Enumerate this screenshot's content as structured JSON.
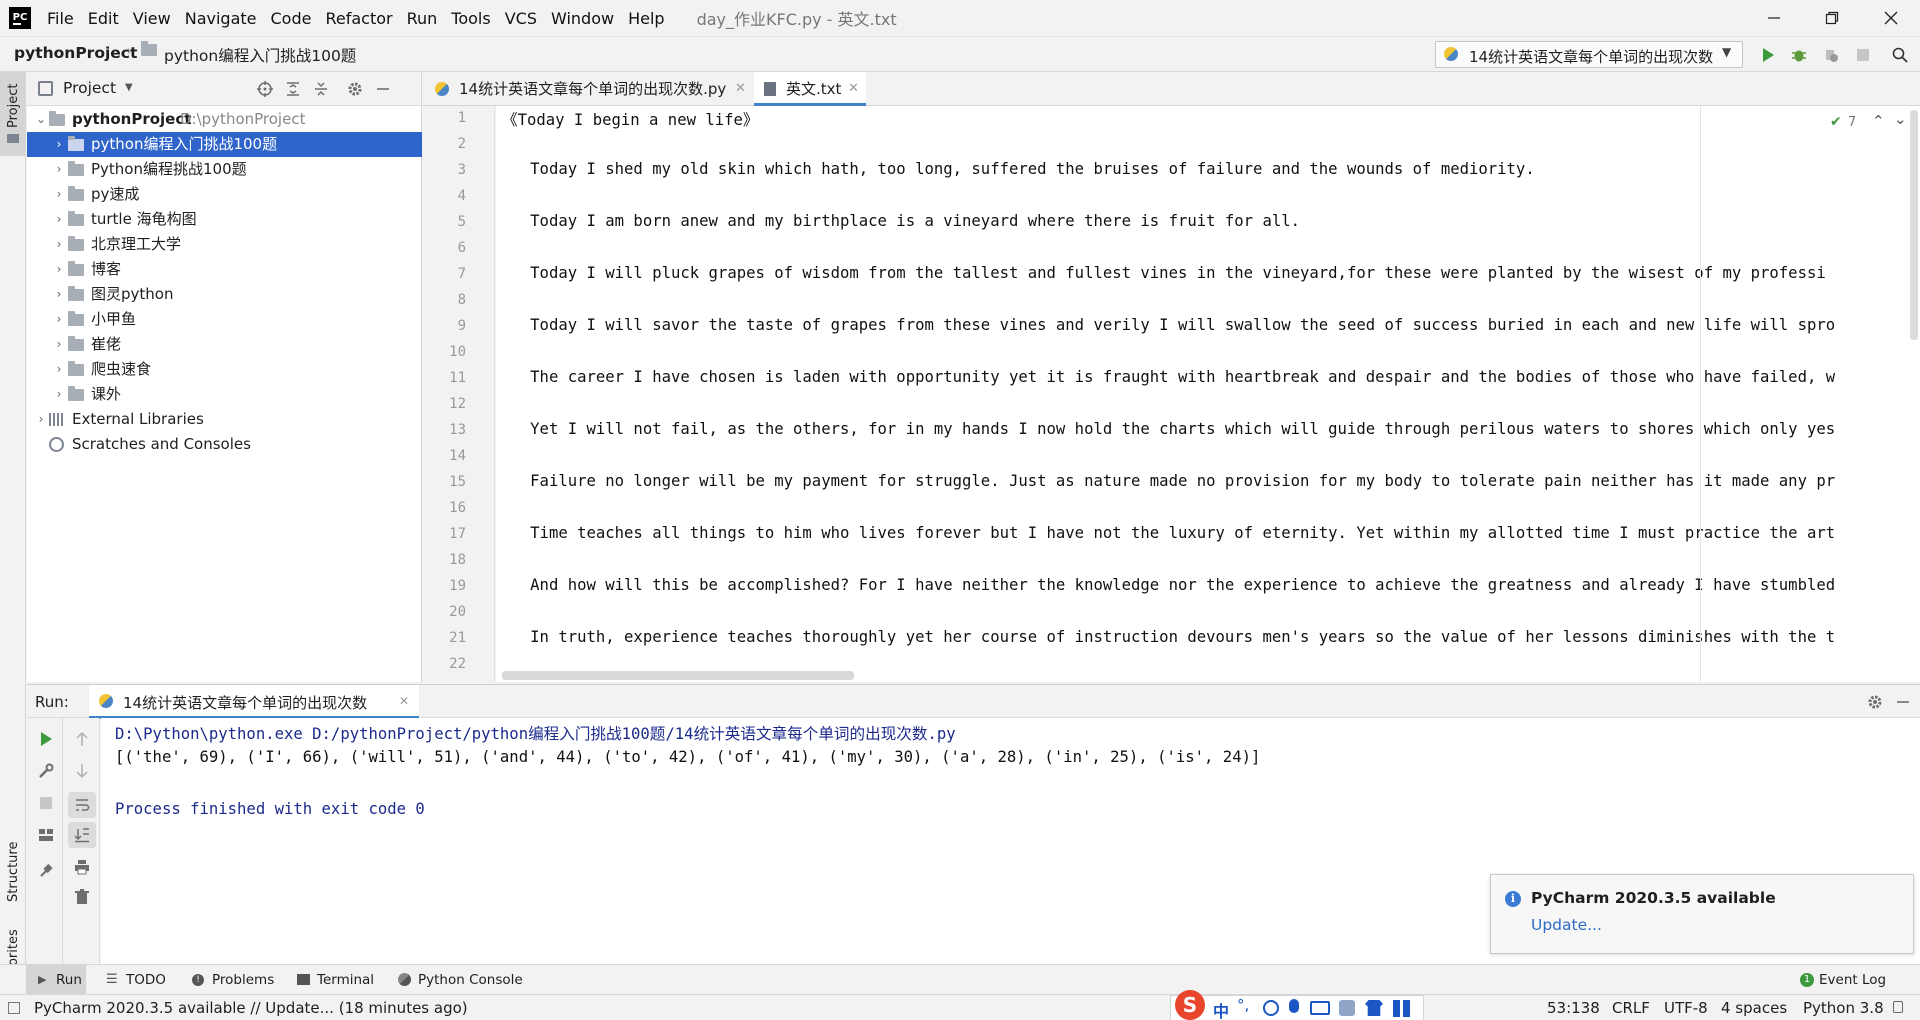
{
  "menubar": {
    "logo": "PC",
    "items": [
      "File",
      "Edit",
      "View",
      "Navigate",
      "Code",
      "Refactor",
      "Run",
      "Tools",
      "VCS",
      "Window",
      "Help"
    ],
    "window_title": "day_作业KFC.py - 英文.txt"
  },
  "navbar": {
    "project": "pythonProject",
    "folder": "python编程入门挑战100题",
    "run_config": "14统计英语文章每个单词的出现次数"
  },
  "left_strip": {
    "project_label": "Project",
    "structure_label": "Structure",
    "favorites_label": "Favorites"
  },
  "project_panel": {
    "title": "Project",
    "root": {
      "name": "pythonProject",
      "path": "D:\\pythonProject"
    },
    "folders": [
      "python编程入门挑战100题",
      "Python编程挑战100题",
      "py速成",
      "turtle 海龟构图",
      "北京理工大学",
      "博客",
      "图灵python",
      "小甲鱼",
      "崔佬",
      "爬虫速食",
      "课外"
    ],
    "external": "External Libraries",
    "scratches": "Scratches and Consoles"
  },
  "editor": {
    "tabs": [
      {
        "label": "14统计英语文章每个单词的出现次数.py"
      },
      {
        "label": "英文.txt"
      }
    ],
    "inspection_count": "7",
    "line_numbers": [
      "1",
      "2",
      "3",
      "4",
      "5",
      "6",
      "7",
      "8",
      "9",
      "10",
      "11",
      "12",
      "13",
      "14",
      "15",
      "16",
      "17",
      "18",
      "19",
      "20",
      "21",
      "22"
    ],
    "lines": [
      "《Today I begin a new life》",
      "",
      "   Today I shed my old skin which hath, too long, suffered the bruises of failure and the wounds of mediority.",
      "",
      "   Today I am born anew and my birthplace is a vineyard where there is fruit for all.",
      "",
      "   Today I will pluck grapes of wisdom from the tallest and fullest vines in the vineyard,for these were planted by the wisest of my professi",
      "",
      "   Today I will savor the taste of grapes from these vines and verily I will swallow the seed of success buried in each and new life will spro",
      "",
      "   The career I have chosen is laden with opportunity yet it is fraught with heartbreak and despair and the bodies of those who have failed, w",
      "",
      "   Yet I will not fail, as the others, for in my hands I now hold the charts which will guide through perilous waters to shores which only yes",
      "",
      "   Failure no longer will be my payment for struggle. Just as nature made no provision for my body to tolerate pain neither has it made any pr",
      "",
      "   Time teaches all things to him who lives forever but I have not the luxury of eternity. Yet within my allotted time I must practice the art",
      "",
      "   And how will this be accomplished? For I have neither the knowledge nor the experience to achieve the greatness and already I have stumbled",
      "",
      "   In truth, experience teaches thoroughly yet her course of instruction devours men's years so the value of her lessons diminishes with the t",
      ""
    ]
  },
  "run": {
    "label": "Run:",
    "tab": "14统计英语文章每个单词的出现次数",
    "console": [
      "D:\\Python\\python.exe D:/pythonProject/python编程入门挑战100题/14统计英语文章每个单词的出现次数.py",
      "[('the', 69), ('I', 66), ('will', 51), ('and', 44), ('to', 42), ('of', 41), ('my', 30), ('a', 28), ('in', 25), ('is', 24)]",
      "",
      "Process finished with exit code 0"
    ]
  },
  "notification": {
    "title": "PyCharm 2020.3.5 available",
    "link": "Update..."
  },
  "bottom_tools": {
    "run": "Run",
    "todo": "TODO",
    "problems": "Problems",
    "terminal": "Terminal",
    "python_console": "Python Console",
    "event_log": "Event Log"
  },
  "statusbar": {
    "message": "PyCharm 2020.3.5 available // Update... (18 minutes ago)",
    "position": "53:138",
    "line_sep": "CRLF",
    "encoding": "UTF-8",
    "indent": "4 spaces",
    "interpreter": "Python 3.8",
    "ime": "中"
  },
  "colors": {
    "selection": "#2f65ca",
    "console_text": "#1c2a8c",
    "link": "#2b6bc4",
    "run_green": "#3d9a3d"
  }
}
